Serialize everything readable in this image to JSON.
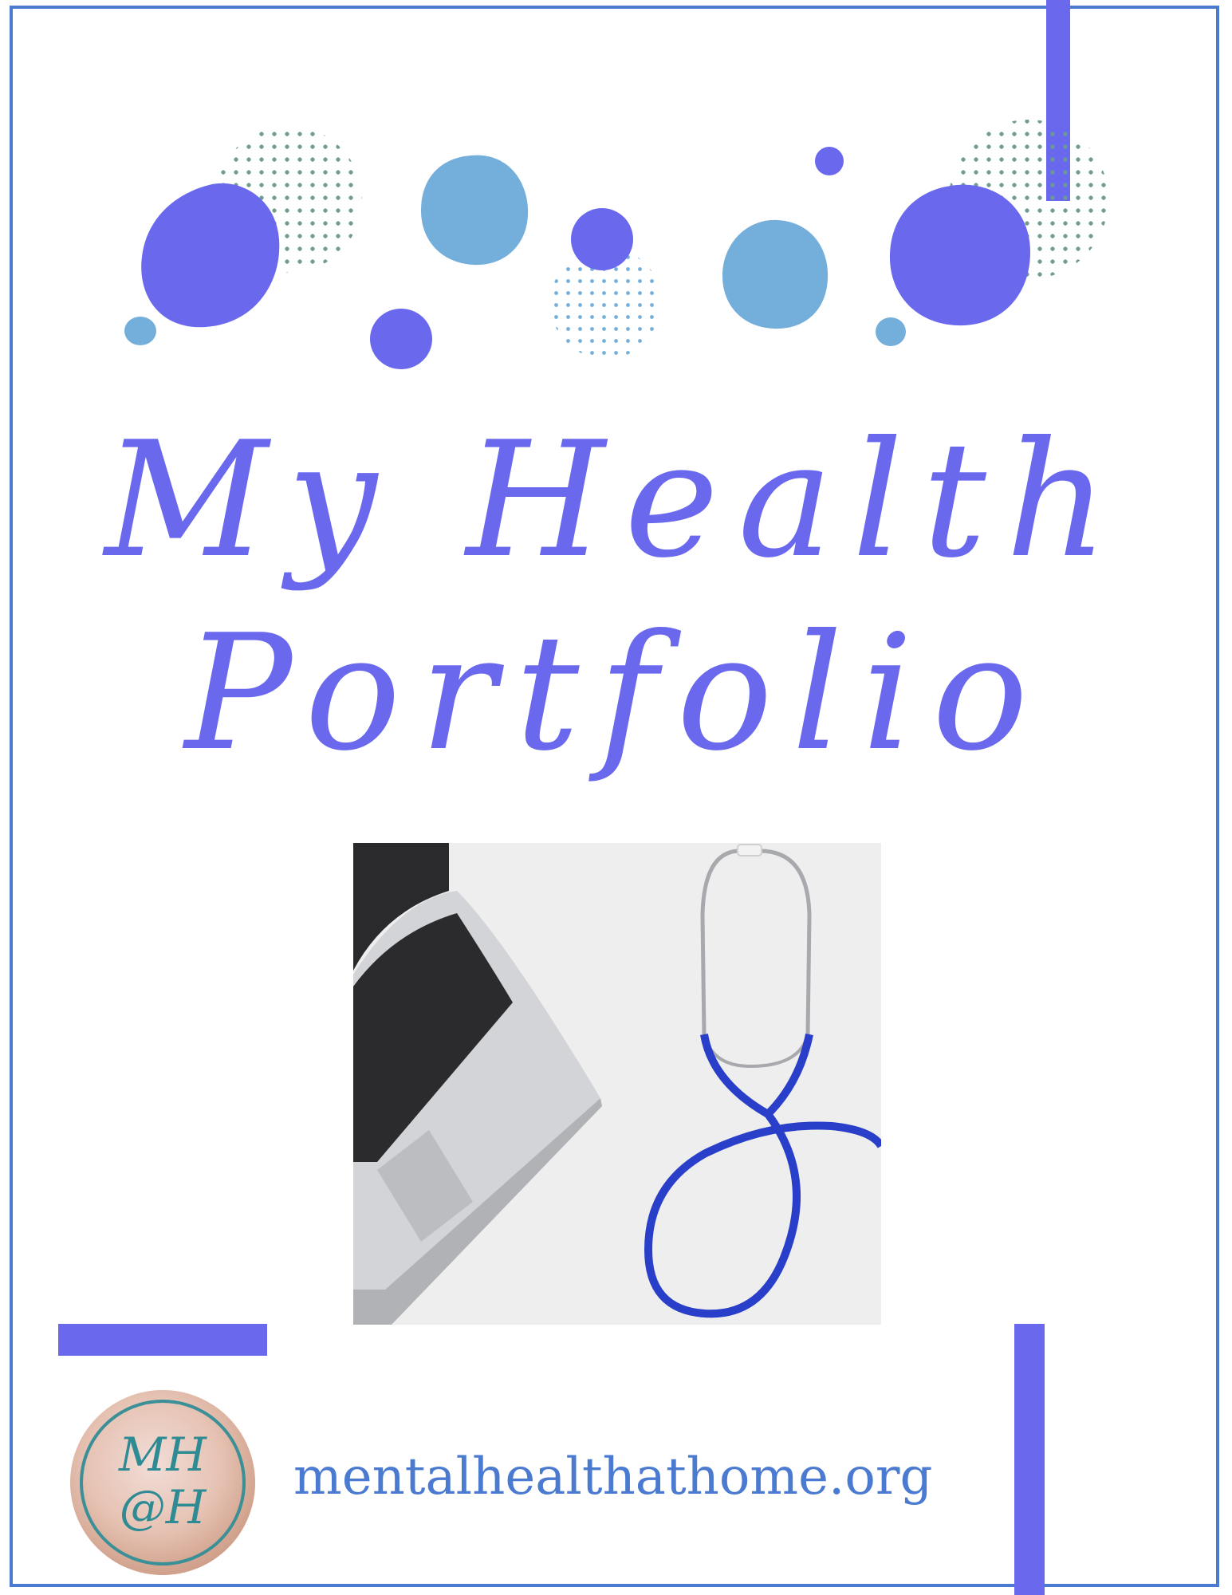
{
  "title": {
    "line1": "My Health",
    "line2": "Portfolio"
  },
  "cover_image": {
    "icon_laptop": "laptop-icon",
    "icon_stethoscope": "stethoscope-icon"
  },
  "logo": {
    "line1": "MH",
    "line2": "@H"
  },
  "footer": {
    "website": "mentalhealthathome.org"
  },
  "colors": {
    "accent_purple": "#6a69ee",
    "accent_light_blue": "#74aedb",
    "frame_blue": "#4a7bd0",
    "dots_green": "#6f9a8f",
    "logo_teal": "#2f8b93",
    "stethoscope_blue": "#2a3fc9"
  }
}
